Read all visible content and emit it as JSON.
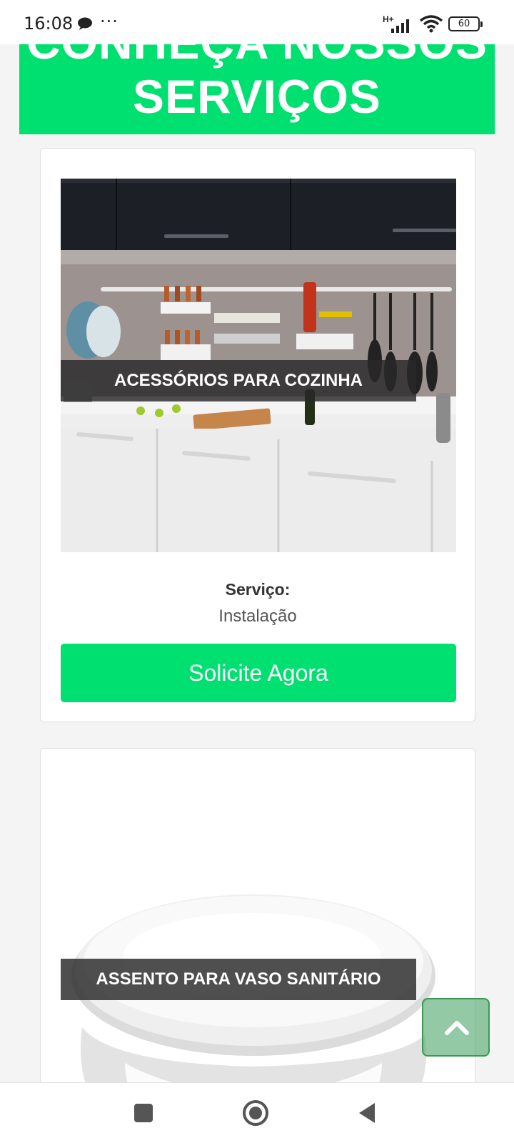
{
  "status_bar": {
    "time": "16:08",
    "dots": "···",
    "network": "H+",
    "battery": "60",
    "icons": [
      "chat-bubble-icon",
      "signal-icon",
      "wifi-icon",
      "battery-icon"
    ]
  },
  "banner": {
    "line1": "CONHEÇA NOSSOS",
    "line2": "SERVIÇOS",
    "color": "#00e070"
  },
  "cards": [
    {
      "title": "ACESSÓRIOS PARA COZINHA",
      "service_label": "Serviço:",
      "service_value": "Instalação",
      "button_label": "Solicite Agora"
    },
    {
      "title": "ASSENTO PARA VASO SANITÁRIO"
    }
  ],
  "scroll_top": {
    "icon": "chevron-up-icon"
  },
  "nav_bar": {
    "icons": [
      "recents-square-icon",
      "home-circle-icon",
      "back-triangle-icon"
    ]
  },
  "colors": {
    "accent": "#00e070",
    "overlay": "#282828",
    "background": "#f4f4f4"
  }
}
